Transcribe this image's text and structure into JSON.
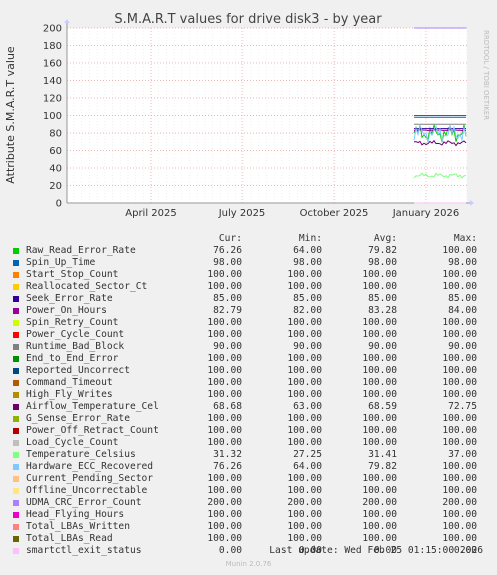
{
  "chart_data": {
    "type": "line",
    "title": "S.M.A.R.T values for drive disk3 - by year",
    "ylabel": "Attribute S.M.A.R.T value",
    "ylim": [
      0,
      200
    ],
    "yticks": [
      0,
      20,
      40,
      60,
      80,
      100,
      120,
      140,
      160,
      180,
      200
    ],
    "xticks": [
      "April 2025",
      "July 2025",
      "October 2025",
      "January 2026"
    ],
    "grid": true,
    "legend_columns": [
      "Cur:",
      "Min:",
      "Avg:",
      "Max:"
    ],
    "series": [
      {
        "name": "Raw_Read_Error_Rate",
        "color": "#00cc00",
        "cur": "76.26",
        "min": "64.00",
        "avg": "79.82",
        "max": "100.00"
      },
      {
        "name": "Spin_Up_Time",
        "color": "#0066b3",
        "cur": "98.00",
        "min": "98.00",
        "avg": "98.00",
        "max": "98.00"
      },
      {
        "name": "Start_Stop_Count",
        "color": "#ff8000",
        "cur": "100.00",
        "min": "100.00",
        "avg": "100.00",
        "max": "100.00"
      },
      {
        "name": "Reallocated_Sector_Ct",
        "color": "#ffcc00",
        "cur": "100.00",
        "min": "100.00",
        "avg": "100.00",
        "max": "100.00"
      },
      {
        "name": "Seek_Error_Rate",
        "color": "#330099",
        "cur": "85.00",
        "min": "85.00",
        "avg": "85.00",
        "max": "85.00"
      },
      {
        "name": "Power_On_Hours",
        "color": "#990099",
        "cur": "82.79",
        "min": "82.00",
        "avg": "83.28",
        "max": "84.00"
      },
      {
        "name": "Spin_Retry_Count",
        "color": "#ccff00",
        "cur": "100.00",
        "min": "100.00",
        "avg": "100.00",
        "max": "100.00"
      },
      {
        "name": "Power_Cycle_Count",
        "color": "#ff0000",
        "cur": "100.00",
        "min": "100.00",
        "avg": "100.00",
        "max": "100.00"
      },
      {
        "name": "Runtime_Bad_Block",
        "color": "#808080",
        "cur": "90.00",
        "min": "90.00",
        "avg": "90.00",
        "max": "90.00"
      },
      {
        "name": "End_to_End_Error",
        "color": "#008f00",
        "cur": "100.00",
        "min": "100.00",
        "avg": "100.00",
        "max": "100.00"
      },
      {
        "name": "Reported_Uncorrect",
        "color": "#00487d",
        "cur": "100.00",
        "min": "100.00",
        "avg": "100.00",
        "max": "100.00"
      },
      {
        "name": "Command_Timeout",
        "color": "#b35a00",
        "cur": "100.00",
        "min": "100.00",
        "avg": "100.00",
        "max": "100.00"
      },
      {
        "name": "High_Fly_Writes",
        "color": "#b38f00",
        "cur": "100.00",
        "min": "100.00",
        "avg": "100.00",
        "max": "100.00"
      },
      {
        "name": "Airflow_Temperature_Cel",
        "color": "#6b006b",
        "cur": "68.68",
        "min": "63.00",
        "avg": "68.59",
        "max": "72.75"
      },
      {
        "name": "G_Sense_Error_Rate",
        "color": "#8fb300",
        "cur": "100.00",
        "min": "100.00",
        "avg": "100.00",
        "max": "100.00"
      },
      {
        "name": "Power_Off_Retract_Count",
        "color": "#b30000",
        "cur": "100.00",
        "min": "100.00",
        "avg": "100.00",
        "max": "100.00"
      },
      {
        "name": "Load_Cycle_Count",
        "color": "#bebebe",
        "cur": "100.00",
        "min": "100.00",
        "avg": "100.00",
        "max": "100.00"
      },
      {
        "name": "Temperature_Celsius",
        "color": "#80ff80",
        "cur": "31.32",
        "min": "27.25",
        "avg": "31.41",
        "max": "37.00"
      },
      {
        "name": "Hardware_ECC_Recovered",
        "color": "#80c9ff",
        "cur": "76.26",
        "min": "64.00",
        "avg": "79.82",
        "max": "100.00"
      },
      {
        "name": "Current_Pending_Sector",
        "color": "#ffc080",
        "cur": "100.00",
        "min": "100.00",
        "avg": "100.00",
        "max": "100.00"
      },
      {
        "name": "Offline_Uncorrectable",
        "color": "#ffe680",
        "cur": "100.00",
        "min": "100.00",
        "avg": "100.00",
        "max": "100.00"
      },
      {
        "name": "UDMA_CRC_Error_Count",
        "color": "#aa80ff",
        "cur": "200.00",
        "min": "200.00",
        "avg": "200.00",
        "max": "200.00"
      },
      {
        "name": "Head_Flying_Hours",
        "color": "#ee00cc",
        "cur": "100.00",
        "min": "100.00",
        "avg": "100.00",
        "max": "100.00"
      },
      {
        "name": "Total_LBAs_Written",
        "color": "#ff8080",
        "cur": "100.00",
        "min": "100.00",
        "avg": "100.00",
        "max": "100.00"
      },
      {
        "name": "Total_LBAs_Read",
        "color": "#666600",
        "cur": "100.00",
        "min": "100.00",
        "avg": "100.00",
        "max": "100.00"
      },
      {
        "name": "smartctl_exit_status",
        "color": "#ffbfff",
        "cur": "0.00",
        "min": "0.00",
        "avg": "0.00",
        "max": "0.00"
      }
    ]
  },
  "footer": {
    "last_update": "Last update: Wed Feb 25 01:15:00 2026",
    "munin_version": "Munin 2.0.76",
    "rrdtool_watermark": "RRDTOOL / TOBI OETIKER"
  }
}
